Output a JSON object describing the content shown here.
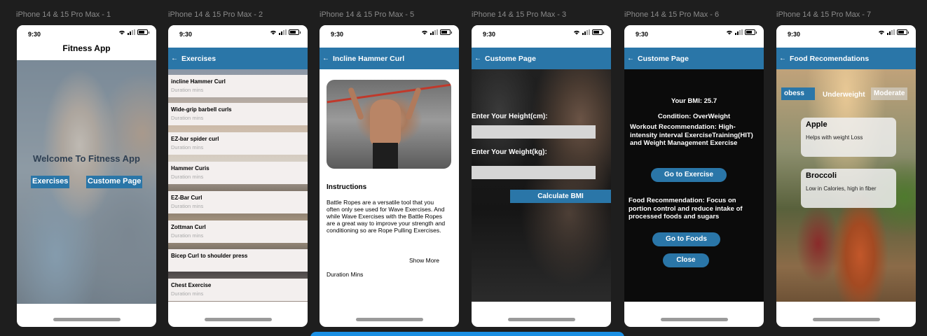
{
  "time": "9:30",
  "frames": [
    {
      "label": "iPhone 14 & 15 Pro Max - 1"
    },
    {
      "label": "iPhone 14 & 15 Pro Max - 2"
    },
    {
      "label": "iPhone 14 & 15 Pro Max - 5"
    },
    {
      "label": "iPhone 14 & 15 Pro Max - 3"
    },
    {
      "label": "iPhone 14 & 15 Pro Max - 6"
    },
    {
      "label": "iPhone 14 & 15 Pro Max - 7"
    }
  ],
  "home": {
    "title": "Fitness App",
    "welcome": "Welcome To Fitness App",
    "exercises_btn": "Exercises",
    "custom_btn": "Custome Page"
  },
  "exercises": {
    "title": "Exercises",
    "duration": "Duration mins",
    "items": [
      "incline Hammer Curl",
      "Wide-grip barbell curls",
      "EZ-bar spider curl",
      "Hammer Curis",
      "EZ-Bar Curl",
      "Zottman Curl",
      "Bicep Curl to  shoulder press",
      "Chest Exercise"
    ]
  },
  "detail": {
    "title": "Incline Hammer Curl",
    "instructions_heading": "Instructions",
    "description": "Battle Ropes are a versatile tool that you often only see used for Wave Exercises. And while Wave Exercises with the Battle Ropes are a great  way to improve your strength and conditioning so are Rope Pulling Exercises.",
    "show_more": "Show More",
    "duration": "Duration Mins"
  },
  "bmi_form": {
    "title": "Custome Page",
    "height_label": "Enter Your Height(cm):",
    "weight_label": "Enter Your Weight(kg):",
    "calc_btn": "Calculate BMI"
  },
  "bmi_result": {
    "title": "Custome Page",
    "bmi": "Your BMI: 25.7",
    "condition": "Condition: OverWeight",
    "workout": "Workout Recommendation: High-intensity interval ExerciseTraining(HIT) and Weight Management Exercise",
    "go_exercise": "Go to Exercise",
    "food": "Food Recommendation: Focus on portion control and reduce intake of processed foods and sugars",
    "go_foods": "Go to Foods",
    "close": "Close"
  },
  "foods": {
    "title": "Food Recomendations",
    "tags": [
      "obess",
      "Underweight",
      "Moderate"
    ],
    "items": [
      {
        "name": "Apple",
        "desc": "Helps with weight Loss"
      },
      {
        "name": "Broccoli",
        "desc": "Low in Calories, high in fiber"
      }
    ]
  },
  "colors": {
    "accent": "#2a76a8",
    "background": "#1e1e1e"
  }
}
